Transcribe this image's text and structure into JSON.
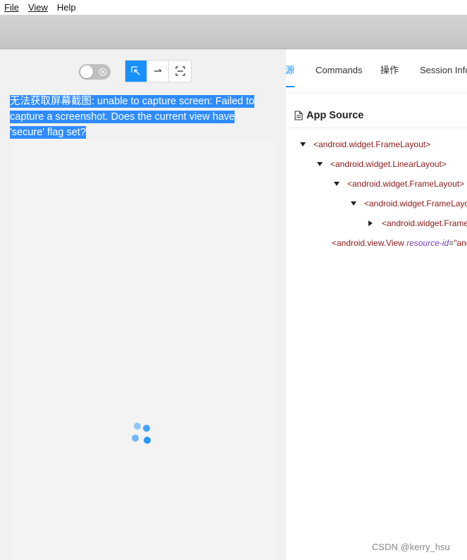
{
  "menubar": {
    "file": "File",
    "view": "View",
    "help": "Help"
  },
  "toolbar": {
    "toggle_state": "off",
    "modes": [
      "select-icon",
      "swipe-icon",
      "tap-coordinates-icon"
    ],
    "active_mode": "select-icon"
  },
  "error": {
    "message": "无法获取屏幕截图: unable to capture screen: Failed to capture a screenshot. Does the current view have 'secure' flag set?"
  },
  "tabs": [
    {
      "label": "源",
      "active": true
    },
    {
      "label": "Commands",
      "active": false
    },
    {
      "label": "操作",
      "active": false
    },
    {
      "label": "Session Infor",
      "active": false
    }
  ],
  "source": {
    "title": "App Source",
    "tree": [
      {
        "text": "<android.widget.FrameLayout>",
        "expanded": true
      },
      {
        "text": "<android.widget.LinearLayout>",
        "expanded": true
      },
      {
        "text": "<android.widget.FrameLayout>",
        "expanded": true
      },
      {
        "text": "<android.widget.FrameLayo",
        "expanded": true
      },
      {
        "text": "<android.widget.Frame",
        "expanded": false
      },
      {
        "text": "<android.view.View",
        "attr_name": "resource-id",
        "attr_value": "\"and"
      }
    ]
  },
  "watermark": "CSDN @kerry_hsu",
  "colors": {
    "accent": "#1890ff",
    "tag": "#8b1a1a",
    "attribute": "#7b3fbf"
  }
}
